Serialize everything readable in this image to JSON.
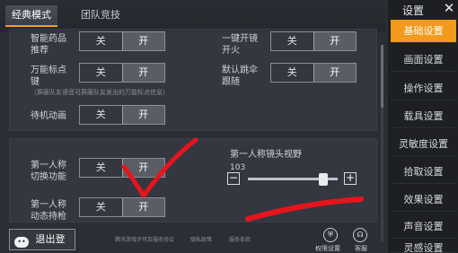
{
  "tabs": [
    {
      "label": "经典模式"
    },
    {
      "label": "团队竞技"
    }
  ],
  "settings": {
    "off_label": "关",
    "on_label": "开",
    "rows": [
      {
        "label_l1": "智能药品",
        "label_l2": "推荐"
      },
      {
        "label_l1": "万能标点",
        "label_l2": "键"
      },
      {
        "label_l1": "待机动画",
        "label_l2": ""
      },
      {
        "label_l1": "一键开镜",
        "label_l2": "开火"
      },
      {
        "label_l1": "默认跳伞",
        "label_l2": "跟随"
      },
      {
        "label_l1": "第一人称",
        "label_l2": "切换功能"
      },
      {
        "label_l1": "第一人称",
        "label_l2": "动态持枪"
      }
    ],
    "marker_hint": "（屏蔽队友语音可屏蔽队友发出的万能标点信息）"
  },
  "fov": {
    "title": "第一人称镜头视野",
    "value": "103",
    "minus": "−",
    "plus": "+",
    "fraction": 0.84
  },
  "sidebar": {
    "title": "设置",
    "close": "✕",
    "items": [
      {
        "label": "基础设置"
      },
      {
        "label": "画面设置"
      },
      {
        "label": "操作设置"
      },
      {
        "label": "载具设置"
      },
      {
        "label": "灵敏度设置"
      },
      {
        "label": "拾取设置"
      },
      {
        "label": "效果设置"
      },
      {
        "label": "声音设置"
      },
      {
        "label": "灵感设置"
      }
    ]
  },
  "bottom": {
    "logout": "退出登录",
    "links": [
      "腾讯游戏许可及服务协议",
      "隐私政策",
      "服务条款"
    ],
    "permission": "权限设置",
    "service": "客服"
  },
  "colors": {
    "accent": "#f29a1b",
    "annotation": "#e8141c"
  }
}
